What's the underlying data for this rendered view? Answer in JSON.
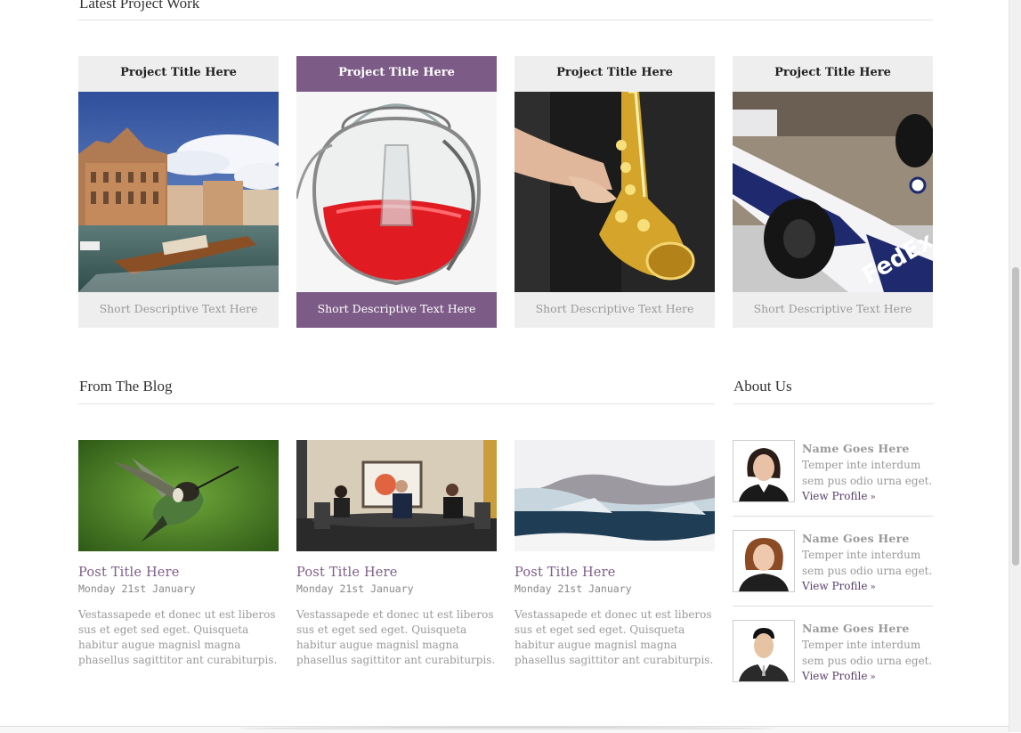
{
  "latest": {
    "heading": "Latest Project Work",
    "projects": [
      {
        "title": "Project Title Here",
        "description": "Short Descriptive Text Here",
        "image": "venice-canal-photo"
      },
      {
        "title": "Project Title Here",
        "description": "Short Descriptive Text Here",
        "image": "wine-decanter-photo"
      },
      {
        "title": "Project Title Here",
        "description": "Short Descriptive Text Here",
        "image": "saxophone-photo"
      },
      {
        "title": "Project Title Here",
        "description": "Short Descriptive Text Here",
        "image": "formula-one-car-photo"
      }
    ]
  },
  "blog": {
    "heading": "From The Blog",
    "posts": [
      {
        "title": "Post Title Here",
        "date": "Monday 21st January",
        "excerpt": "Vestassapede et donec ut est liberos sus et eget sed eget. Quisqueta habitur augue magnisl magna phasellus sagittitor ant curabiturpis.",
        "image": "hummingbird-photo"
      },
      {
        "title": "Post Title Here",
        "date": "Monday 21st January",
        "excerpt": "Vestassapede et donec ut est liberos sus et eget sed eget. Quisqueta habitur augue magnisl magna phasellus sagittitor ant curabiturpis.",
        "image": "business-meeting-photo"
      },
      {
        "title": "Post Title Here",
        "date": "Monday 21st January",
        "excerpt": "Vestassapede et donec ut est liberos sus et eget sed eget. Quisqueta habitur augue magnisl magna phasellus sagittitor ant curabiturpis.",
        "image": "glacier-photo"
      }
    ]
  },
  "about": {
    "heading": "About Us",
    "members": [
      {
        "name": "Name Goes Here",
        "text": "Temper inte interdum sem pus odio urna eget.",
        "link": "View Profile",
        "arrow": "»"
      },
      {
        "name": "Name Goes Here",
        "text": "Temper inte interdum sem pus odio urna eget.",
        "link": "View Profile",
        "arrow": "»"
      },
      {
        "name": "Name Goes Here",
        "text": "Temper inte interdum sem pus odio urna eget.",
        "link": "View Profile",
        "arrow": "»"
      }
    ]
  },
  "colors": {
    "accent": "#7d5b87",
    "tile_bg": "#eeeeee",
    "muted_text": "#999999"
  }
}
